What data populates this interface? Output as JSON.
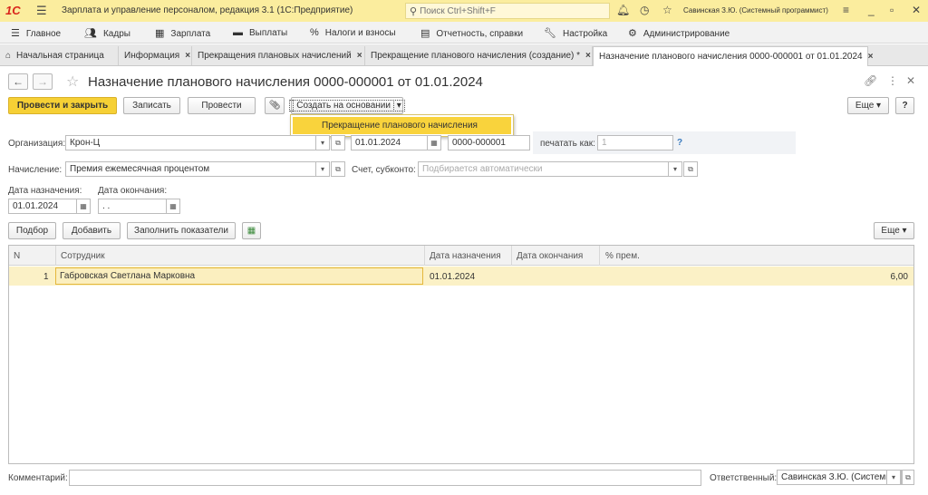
{
  "app": {
    "logo": "1С",
    "title": "Зарплата и управление персоналом, редакция 3.1  (1С:Предприятие)",
    "search_placeholder": "Поиск Ctrl+Shift+F",
    "user": "Савинская З.Ю. (Системный программист)"
  },
  "sections": [
    {
      "label": "Главное",
      "icon": "☰"
    },
    {
      "label": "Кадры",
      "icon": "👥"
    },
    {
      "label": "Зарплата",
      "icon": "▦"
    },
    {
      "label": "Выплаты",
      "icon": "▬"
    },
    {
      "label": "Налоги и взносы",
      "icon": "%"
    },
    {
      "label": "Отчетность, справки",
      "icon": "▤"
    },
    {
      "label": "Настройка",
      "icon": "🔧"
    },
    {
      "label": "Администрирование",
      "icon": "⚙"
    }
  ],
  "tabs": [
    {
      "label": "Начальная страница",
      "icon": "⌂"
    },
    {
      "label": "Информация"
    },
    {
      "label": "Прекращения плановых начислений"
    },
    {
      "label": "Прекращение планового начисления (создание) *"
    },
    {
      "label": "Назначение планового начисления 0000-000001 от 01.01.2024"
    }
  ],
  "doc": {
    "title": "Назначение планового начисления 0000-000001 от 01.01.2024"
  },
  "toolbar": {
    "post_close": "Провести и закрыть",
    "save": "Записать",
    "post": "Провести",
    "create_based": "Создать на основании",
    "more": "Еще",
    "help": "?"
  },
  "dropdown": {
    "item": "Прекращение планового начисления"
  },
  "form": {
    "org_label": "Организация:",
    "org_value": "Крон-Ц",
    "date_value": "01.01.2024",
    "number_value": "0000-000001",
    "print_as_label": "печатать как:",
    "print_as_placeholder": "1",
    "help_q": "?",
    "accrual_label": "Начисление:",
    "accrual_value": "Премия ежемесячная процентом",
    "account_label": "Счет, субконто:",
    "account_placeholder": "Подбирается автоматически",
    "assign_date_label": "Дата назначения:",
    "assign_date_value": "01.01.2024",
    "end_date_label": "Дата окончания:",
    "end_date_value": " .  . "
  },
  "table_toolbar": {
    "select": "Подбор",
    "add": "Добавить",
    "fill": "Заполнить показатели",
    "more": "Еще"
  },
  "table": {
    "columns": [
      "N",
      "Сотрудник",
      "Дата назначения",
      "Дата окончания",
      "% прем."
    ],
    "rows": [
      {
        "n": "1",
        "employee": "Габровская Светлана Марковна",
        "assign_date": "01.01.2024",
        "end_date": "",
        "percent": "6,00"
      }
    ]
  },
  "footer": {
    "comment_label": "Комментарий:",
    "comment_value": "",
    "responsible_label": "Ответственный:",
    "responsible_value": "Савинская З.Ю. (Системный программист)"
  }
}
